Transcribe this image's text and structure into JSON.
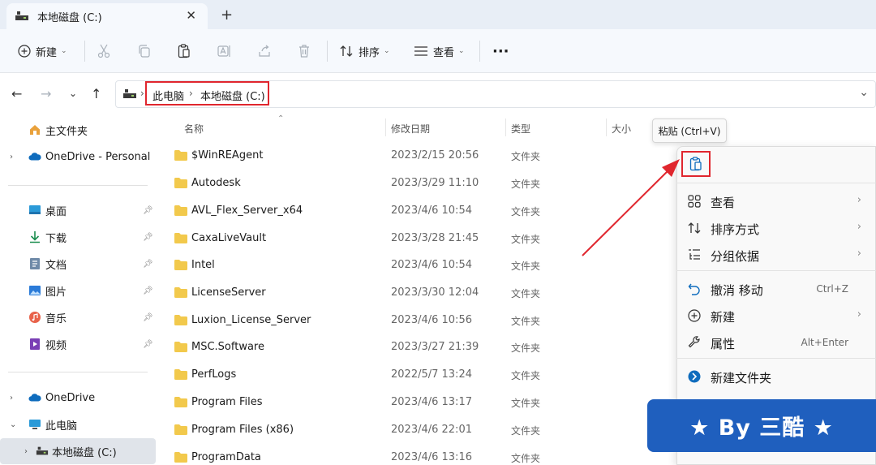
{
  "tab": {
    "title": "本地磁盘 (C:)",
    "close": "✕",
    "new": "+"
  },
  "toolbar": {
    "new_label": "新建",
    "sort_label": "排序",
    "view_label": "查看",
    "more": "···"
  },
  "breadcrumb": [
    "此电脑",
    "本地磁盘 (C:)"
  ],
  "sidebar": {
    "home": "主文件夹",
    "onedrive_personal": "OneDrive - Personal",
    "quick": [
      "桌面",
      "下载",
      "文档",
      "图片",
      "音乐",
      "视频"
    ],
    "onedrive": "OneDrive",
    "this_pc": "此电脑",
    "local_disk": "本地磁盘 (C:)"
  },
  "columns": {
    "name": "名称",
    "date": "修改日期",
    "type": "类型",
    "size": "大小"
  },
  "files": [
    {
      "name": "$WinREAgent",
      "date": "2023/2/15 20:56",
      "type": "文件夹"
    },
    {
      "name": "Autodesk",
      "date": "2023/3/29 11:10",
      "type": "文件夹"
    },
    {
      "name": "AVL_Flex_Server_x64",
      "date": "2023/4/6 10:54",
      "type": "文件夹"
    },
    {
      "name": "CaxaLiveVault",
      "date": "2023/3/28 21:45",
      "type": "文件夹"
    },
    {
      "name": "Intel",
      "date": "2023/4/6 10:54",
      "type": "文件夹"
    },
    {
      "name": "LicenseServer",
      "date": "2023/3/30 12:04",
      "type": "文件夹"
    },
    {
      "name": "Luxion_License_Server",
      "date": "2023/4/6 10:56",
      "type": "文件夹"
    },
    {
      "name": "MSC.Software",
      "date": "2023/3/27 21:39",
      "type": "文件夹"
    },
    {
      "name": "PerfLogs",
      "date": "2022/5/7 13:24",
      "type": "文件夹"
    },
    {
      "name": "Program Files",
      "date": "2023/4/6 13:17",
      "type": "文件夹"
    },
    {
      "name": "Program Files (x86)",
      "date": "2023/4/6 22:01",
      "type": "文件夹"
    },
    {
      "name": "ProgramData",
      "date": "2023/4/6 13:16",
      "type": "文件夹"
    }
  ],
  "tooltip": "粘贴 (Ctrl+V)",
  "context_menu": {
    "view": "查看",
    "sort": "排序方式",
    "group": "分组依据",
    "undo": "撤消 移动",
    "undo_shortcut": "Ctrl+Z",
    "new": "新建",
    "properties": "属性",
    "properties_shortcut": "Alt+Enter",
    "new_folder": "新建文件夹"
  },
  "banner": "★ By 三酷 ★",
  "colors": {
    "accent": "#1f5fbe",
    "highlight": "#e0262e",
    "folder": "#f2c94c"
  }
}
